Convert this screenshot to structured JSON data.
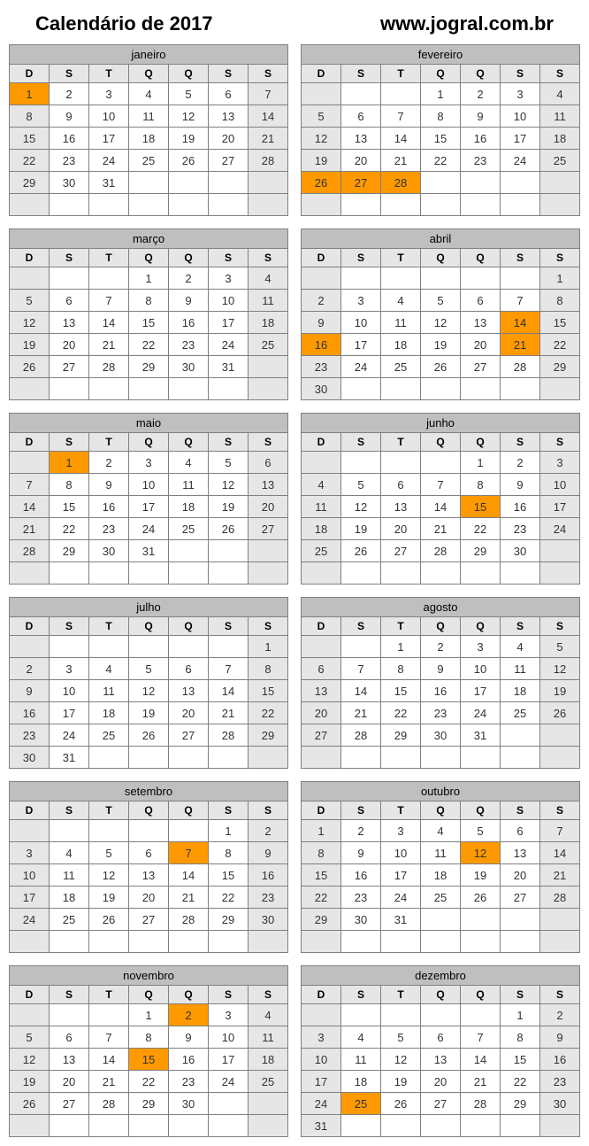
{
  "header": {
    "title": "Calendário de 2017",
    "site": "www.jogral.com.br"
  },
  "dow": [
    "D",
    "S",
    "T",
    "Q",
    "Q",
    "S",
    "S"
  ],
  "months": [
    {
      "name": "janeiro",
      "start": 0,
      "days": 31,
      "hl": [
        1
      ]
    },
    {
      "name": "fevereiro",
      "start": 3,
      "days": 28,
      "hl": [
        26,
        27,
        28
      ]
    },
    {
      "name": "março",
      "start": 3,
      "days": 31,
      "hl": []
    },
    {
      "name": "abril",
      "start": 6,
      "days": 30,
      "hl": [
        14,
        16,
        21
      ]
    },
    {
      "name": "maio",
      "start": 1,
      "days": 31,
      "hl": [
        1
      ]
    },
    {
      "name": "junho",
      "start": 4,
      "days": 30,
      "hl": [
        15
      ]
    },
    {
      "name": "julho",
      "start": 6,
      "days": 31,
      "hl": []
    },
    {
      "name": "agosto",
      "start": 2,
      "days": 31,
      "hl": []
    },
    {
      "name": "setembro",
      "start": 5,
      "days": 30,
      "hl": [
        7
      ]
    },
    {
      "name": "outubro",
      "start": 0,
      "days": 31,
      "hl": [
        12
      ]
    },
    {
      "name": "novembro",
      "start": 3,
      "days": 30,
      "hl": [
        2,
        15
      ]
    },
    {
      "name": "dezembro",
      "start": 5,
      "days": 31,
      "hl": [
        25
      ]
    }
  ]
}
